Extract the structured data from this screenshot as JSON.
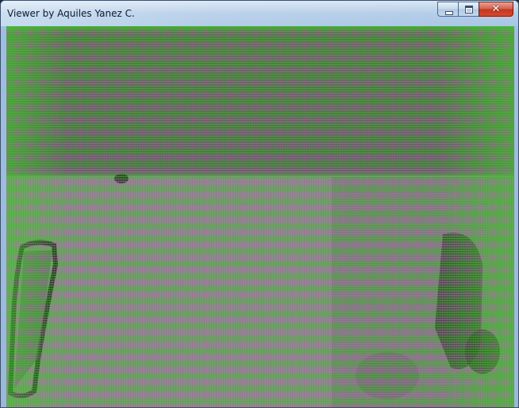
{
  "window": {
    "title": "Viewer by Aquiles Yanez C."
  },
  "caption_buttons": {
    "minimize_icon": "minimize-icon",
    "maximize_icon": "maximize-icon",
    "close_icon": "close-icon",
    "close_glyph": "✕"
  },
  "colors": {
    "accent_close": "#c4371f",
    "scanline_green": "#3fbf2a",
    "scanline_magenta": "#b24aa4"
  }
}
